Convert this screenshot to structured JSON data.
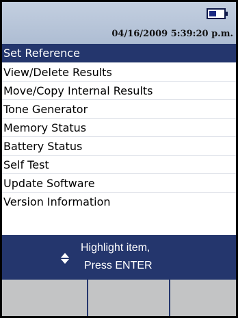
{
  "status_bar": {
    "datetime": "04/16/2009  5:39:20 p.m.",
    "battery_icon": "battery-icon",
    "battery_level": 0.5
  },
  "menu": {
    "items": [
      {
        "label": "Set Reference",
        "selected": true
      },
      {
        "label": "View/Delete Results",
        "selected": false
      },
      {
        "label": "Move/Copy Internal Results",
        "selected": false
      },
      {
        "label": "Tone Generator",
        "selected": false
      },
      {
        "label": "Memory Status",
        "selected": false
      },
      {
        "label": "Battery Status",
        "selected": false
      },
      {
        "label": "Self Test",
        "selected": false
      },
      {
        "label": "Update Software",
        "selected": false
      },
      {
        "label": "Version Information",
        "selected": false
      }
    ]
  },
  "instruction": {
    "icon": "up-down-arrows-icon",
    "line1": "Highlight item,",
    "line2": "Press ENTER"
  },
  "softkeys": [
    {
      "label": ""
    },
    {
      "label": ""
    },
    {
      "label": ""
    }
  ],
  "colors": {
    "header_bg": "#aebdd3",
    "accent": "#24366d",
    "softkey_bg": "#c3c4c5"
  }
}
